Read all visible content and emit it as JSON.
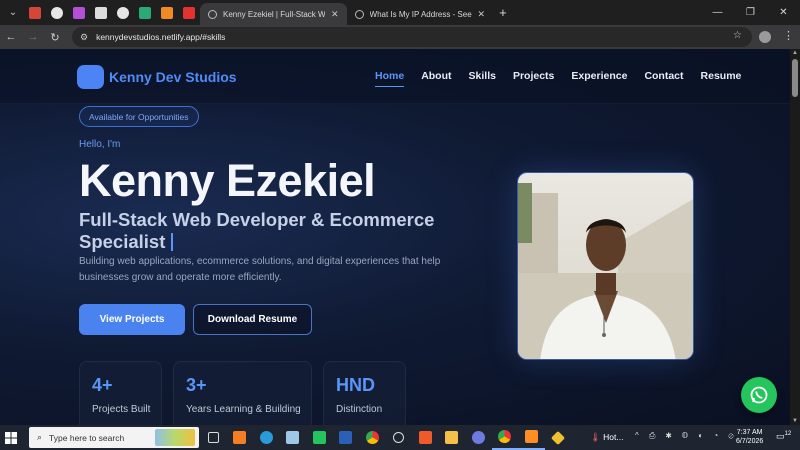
{
  "browser": {
    "tabs": [
      {
        "title": "Kenny Ezekiel | Full-Stack Web D",
        "active": true
      },
      {
        "title": "What Is My IP Address - See Yo",
        "active": false
      }
    ],
    "url": "kennydevstudios.netlify.app/#skills"
  },
  "site": {
    "logo_text": "Kenny Dev Studios",
    "nav": [
      {
        "label": "Home",
        "active": true
      },
      {
        "label": "About",
        "active": false
      },
      {
        "label": "Skills",
        "active": false
      },
      {
        "label": "Projects",
        "active": false
      },
      {
        "label": "Experience",
        "active": false
      },
      {
        "label": "Contact",
        "active": false
      },
      {
        "label": "Resume",
        "active": false
      }
    ]
  },
  "hero": {
    "badge": "Available for Opportunities",
    "greeting": "Hello, I'm",
    "name": "Kenny Ezekiel",
    "role": "Full-Stack Web Developer & Ecommerce Specialist",
    "description": "Building web applications, ecommerce solutions, and digital experiences that help businesses grow and operate more efficiently.",
    "primary_button": "View Projects",
    "secondary_button": "Download Resume",
    "stats": [
      {
        "value": "4+",
        "label": "Projects Built"
      },
      {
        "value": "3+",
        "label": "Years Learning & Building"
      },
      {
        "value": "HND",
        "label": "Distinction"
      }
    ]
  },
  "taskbar": {
    "search_placeholder": "Type here to search",
    "weather": "Hot...",
    "time": "7:37 AM",
    "date": "6/7/2026",
    "notifications": "12"
  },
  "colors": {
    "accent": "#4f8cf8",
    "background": "#0c1326",
    "whatsapp": "#25c55e"
  }
}
